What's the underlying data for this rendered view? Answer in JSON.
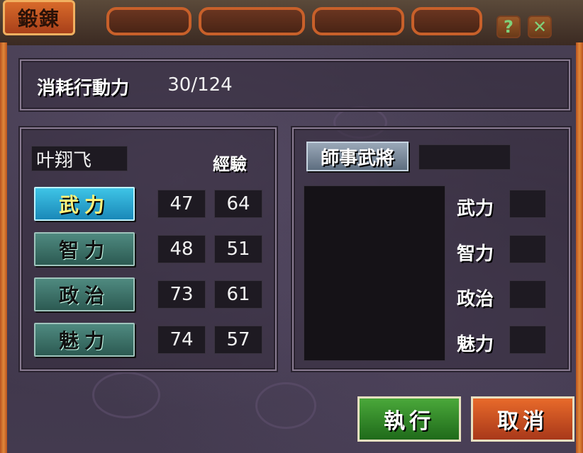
{
  "window": {
    "title": "鍛錬"
  },
  "cost": {
    "label": "消耗行動力",
    "value": "30/124"
  },
  "left_panel": {
    "name": "叶翔飞",
    "exp_header": "經驗",
    "stats": [
      {
        "label": "武力",
        "value": "47",
        "exp": "64",
        "active": true
      },
      {
        "label": "智力",
        "value": "48",
        "exp": "51",
        "active": false
      },
      {
        "label": "政治",
        "value": "73",
        "exp": "61",
        "active": false
      },
      {
        "label": "魅力",
        "value": "74",
        "exp": "57",
        "active": false
      }
    ]
  },
  "right_panel": {
    "mentor_button": "師事武將",
    "mentor_name": "",
    "stats": [
      {
        "label": "武力",
        "value": ""
      },
      {
        "label": "智力",
        "value": ""
      },
      {
        "label": "政治",
        "value": ""
      },
      {
        "label": "魅力",
        "value": ""
      }
    ]
  },
  "buttons": {
    "execute": "執行",
    "cancel": "取消",
    "help_icon": "question-icon",
    "close_icon": "close-icon"
  },
  "colors": {
    "active_stat": "#3ec4e6",
    "stat_button": "#4f8a80",
    "execute": "#4aa83a",
    "cancel": "#e86a2a"
  }
}
